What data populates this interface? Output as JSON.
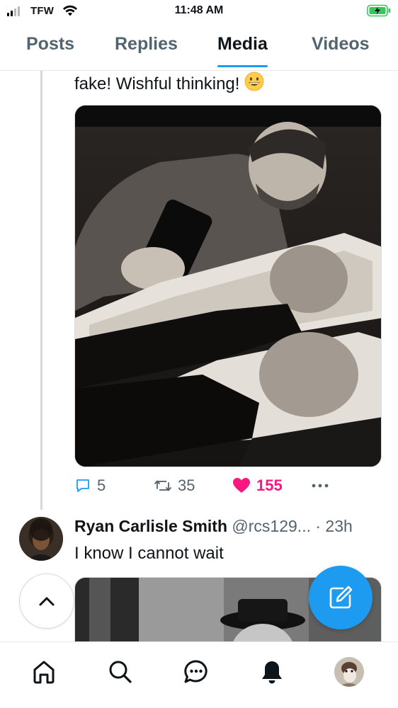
{
  "status_bar": {
    "carrier": "TFW",
    "time": "11:48 AM"
  },
  "tabs": [
    {
      "label": "Posts",
      "active": false
    },
    {
      "label": "Replies",
      "active": false
    },
    {
      "label": "Media",
      "active": true
    },
    {
      "label": "Videos",
      "active": false
    }
  ],
  "post1": {
    "text": "fake! Wishful thinking!",
    "emoji": "grinning-face-icon",
    "stats": {
      "replies": "5",
      "reposts": "35",
      "likes": "155"
    }
  },
  "post2": {
    "author_name": "Ryan Carlisle Smith",
    "handle": "@rcs129...",
    "time": "· 23h",
    "text": "I know I cannot wait"
  },
  "colors": {
    "accent": "#1d9bf0",
    "like": "#f91880",
    "muted": "#536471"
  },
  "nav": [
    "home-icon",
    "search-icon",
    "messages-icon",
    "notifications-icon",
    "profile-avatar"
  ]
}
